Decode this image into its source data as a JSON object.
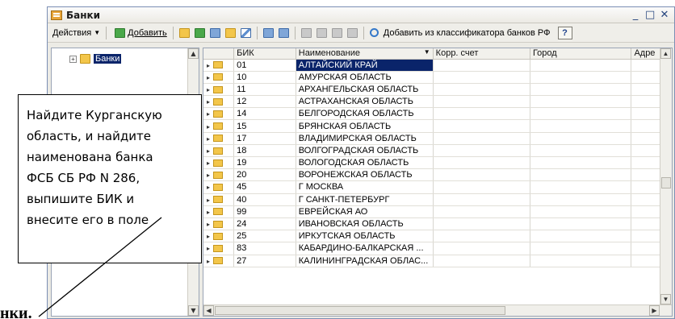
{
  "doc_fragment_bottom": "нки.",
  "window": {
    "title": "Банки",
    "controls": [
      "_",
      "□",
      "✕"
    ]
  },
  "toolbar": {
    "actions_label": "Действия",
    "add_label": "Добавить",
    "add_from_classifier_label": "Добавить из классификатора банков РФ",
    "help_label": "?"
  },
  "tree": {
    "root_label": "Банки"
  },
  "grid": {
    "columns": [
      "БИК",
      "Наименование",
      "Корр. счет",
      "Город",
      "Адре"
    ],
    "rows": [
      {
        "bik": "01",
        "name": "АЛТАЙСКИЙ КРАЙ"
      },
      {
        "bik": "10",
        "name": "АМУРСКАЯ ОБЛАСТЬ"
      },
      {
        "bik": "11",
        "name": "АРХАНГЕЛЬСКАЯ ОБЛАСТЬ"
      },
      {
        "bik": "12",
        "name": "АСТРАХАНСКАЯ ОБЛАСТЬ"
      },
      {
        "bik": "14",
        "name": "БЕЛГОРОДСКАЯ ОБЛАСТЬ"
      },
      {
        "bik": "15",
        "name": "БРЯНСКАЯ ОБЛАСТЬ"
      },
      {
        "bik": "17",
        "name": "ВЛАДИМИРСКАЯ ОБЛАСТЬ"
      },
      {
        "bik": "18",
        "name": "ВОЛГОГРАДСКАЯ ОБЛАСТЬ"
      },
      {
        "bik": "19",
        "name": "ВОЛОГОДСКАЯ ОБЛАСТЬ"
      },
      {
        "bik": "20",
        "name": "ВОРОНЕЖСКАЯ ОБЛАСТЬ"
      },
      {
        "bik": "45",
        "name": "Г МОСКВА"
      },
      {
        "bik": "40",
        "name": "Г САНКТ-ПЕТЕРБУРГ"
      },
      {
        "bik": "99",
        "name": "ЕВРЕЙСКАЯ АО"
      },
      {
        "bik": "24",
        "name": "ИВАНОВСКАЯ ОБЛАСТЬ"
      },
      {
        "bik": "25",
        "name": "ИРКУТСКАЯ ОБЛАСТЬ"
      },
      {
        "bik": "83",
        "name": "КАБАРДИНО-БАЛКАРСКАЯ ..."
      },
      {
        "bik": "27",
        "name": "КАЛИНИНГРАДСКАЯ ОБЛАС..."
      }
    ],
    "selected_row_index": 0
  },
  "callout": {
    "lines": [
      "Найдите Курганскую",
      "область, и найдите",
      "наименована банка",
      "ФСБ СБ РФ N 286,",
      "выпишите БИК и",
      "внесите его в поле"
    ]
  }
}
